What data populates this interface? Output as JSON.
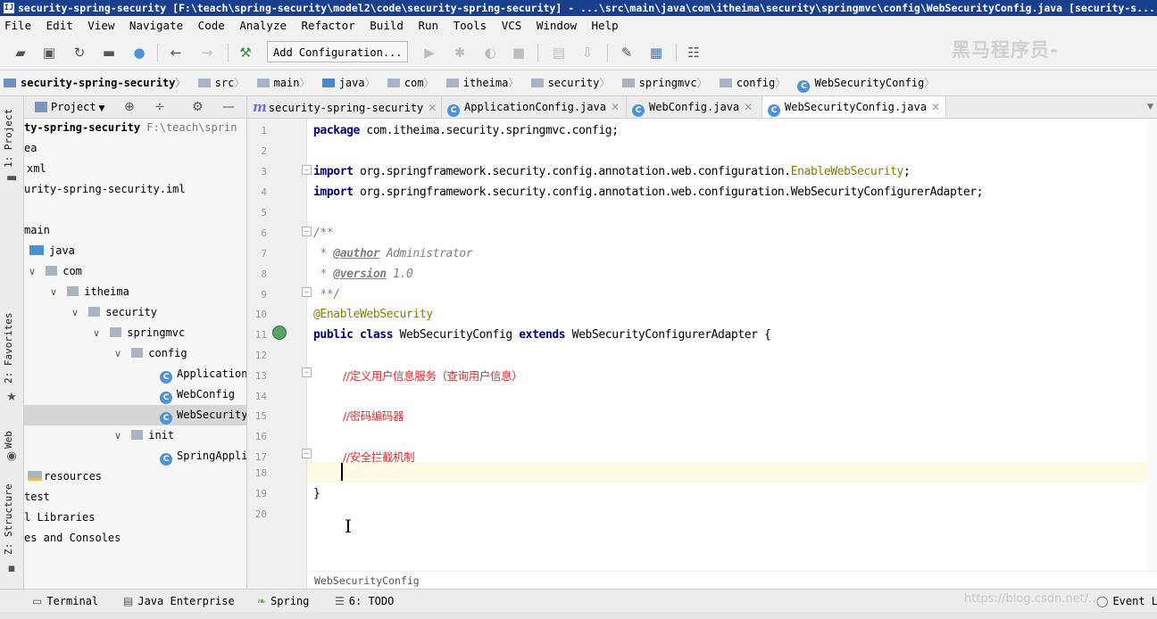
{
  "window": {
    "title": "security-spring-security [F:\\teach\\spring-security\\model2\\code\\security-spring-security] - ...\\src\\main\\java\\com\\itheima\\security\\springmvc\\config\\WebSecurityConfig.java [security-s..."
  },
  "menu": [
    "File",
    "Edit",
    "View",
    "Navigate",
    "Code",
    "Analyze",
    "Refactor",
    "Build",
    "Run",
    "Tools",
    "VCS",
    "Window",
    "Help"
  ],
  "toolbar": {
    "run_config_label": "Add Configuration...",
    "watermark": "黑马程序员-"
  },
  "breadcrumbs": [
    "security-spring-security",
    "src",
    "main",
    "java",
    "com",
    "itheima",
    "security",
    "springmvc",
    "config",
    "WebSecurityConfig"
  ],
  "side_tabs": {
    "project": "1: Project",
    "favorites": "2: Favorites",
    "web": "Web",
    "structure": "Z: Structure"
  },
  "project_panel": {
    "header_label": "Project",
    "tree": [
      {
        "text": "ty-spring-security",
        "extra": "F:\\teach\\sprin",
        "bold": true
      },
      {
        "text": "ea"
      },
      {
        "text": "xml"
      },
      {
        "text": "urity-spring-security.iml"
      },
      {
        "text": ""
      },
      {
        "text": "main"
      },
      {
        "text": "java"
      },
      {
        "text": "com"
      },
      {
        "text": "itheima"
      },
      {
        "text": "security"
      },
      {
        "text": "springmvc"
      },
      {
        "text": "config"
      },
      {
        "text": "ApplicationConfig"
      },
      {
        "text": "WebConfig"
      },
      {
        "text": "WebSecurityConfig"
      },
      {
        "text": "init"
      },
      {
        "text": "SpringApplicationInitializer"
      },
      {
        "text": "resources"
      },
      {
        "text": "test"
      },
      {
        "text": "l Libraries"
      },
      {
        "text": "es and Consoles"
      }
    ]
  },
  "editor_tabs": [
    {
      "label": "security-spring-security"
    },
    {
      "label": "ApplicationConfig.java"
    },
    {
      "label": "WebConfig.java"
    },
    {
      "label": "WebSecurityConfig.java",
      "active": true
    }
  ],
  "code": {
    "line_numbers": [
      "1",
      "2",
      "3",
      "4",
      "5",
      "6",
      "7",
      "8",
      "9",
      "10",
      "11",
      "12",
      "13",
      "14",
      "15",
      "16",
      "17",
      "18",
      "19",
      "20"
    ],
    "l1_kw": "package",
    "l1_rest": " com.itheima.security.springmvc.config;",
    "l3_kw": "import",
    "l3_rest": " org.springframework.security.config.annotation.web.configuration.",
    "l3_cls": "EnableWebSecurity",
    "l3_end": ";",
    "l4_kw": "import",
    "l4_rest": " org.springframework.security.config.annotation.web.configuration.WebSecurityConfigurerAdapter;",
    "l6": "/**",
    "l7_pre": " * ",
    "l7_tag": "@author",
    "l7_val": " Administrator",
    "l8_pre": " * ",
    "l8_tag": "@version",
    "l8_val": " 1.0",
    "l9": " **/",
    "l10": "@EnableWebSecurity",
    "l11_kw1": "public class",
    "l11_mid": " WebSecurityConfig ",
    "l11_kw2": "extends",
    "l11_end": " WebSecurityConfigurerAdapter {",
    "l13": "//定义用户信息服务（查询用户信息）",
    "l15": "//密码编码器",
    "l17": "//安全拦截机制",
    "l19": "}"
  },
  "editor_breadcrumb": "WebSecurityConfig",
  "bottom_tools": [
    {
      "label": "Terminal"
    },
    {
      "label": "Java Enterprise"
    },
    {
      "label": "Spring"
    },
    {
      "label": "6: TODO"
    },
    {
      "label": "Event L"
    }
  ],
  "bottom_watermark": "https://blog.csdn.net/..."
}
